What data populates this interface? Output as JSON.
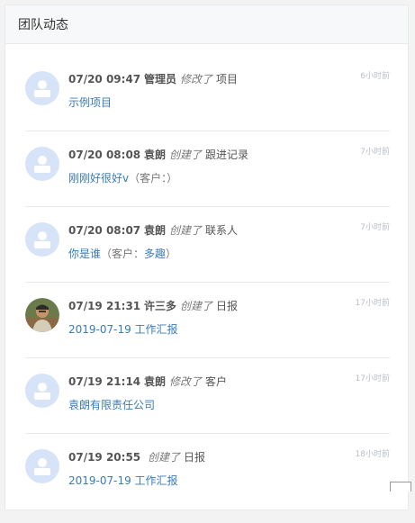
{
  "panel": {
    "title": "团队动态"
  },
  "feed": [
    {
      "time": "07/20 09:47",
      "user": "管理员",
      "action": "修改了",
      "type": "项目",
      "ago": "6小时前",
      "link": "示例项目",
      "customer_label": "",
      "customer": "",
      "customer_close": "",
      "avatar": "default"
    },
    {
      "time": "07/20 08:08",
      "user": "袁朗",
      "action": "创建了",
      "type": "跟进记录",
      "ago": "7小时前",
      "link": "刚刚好很好v",
      "customer_label": "（客户：",
      "customer": "",
      "customer_close": "）",
      "avatar": "default"
    },
    {
      "time": "07/20 08:07",
      "user": "袁朗",
      "action": "创建了",
      "type": "联系人",
      "ago": "7小时前",
      "link": "你是谁",
      "customer_label": "（客户：",
      "customer": "多趣",
      "customer_close": "）",
      "avatar": "default"
    },
    {
      "time": "07/19 21:31",
      "user": "许三多",
      "action": "创建了",
      "type": "日报",
      "ago": "17小时前",
      "link": "2019-07-19 工作汇报",
      "customer_label": "",
      "customer": "",
      "customer_close": "",
      "avatar": "photo"
    },
    {
      "time": "07/19 21:14",
      "user": "袁朗",
      "action": "修改了",
      "type": "客户",
      "ago": "17小时前",
      "link": "袁朗有限责任公司",
      "customer_label": "",
      "customer": "",
      "customer_close": "",
      "avatar": "default"
    },
    {
      "time": "07/19 20:55",
      "user": "",
      "action": "创建了",
      "type": "日报",
      "ago": "18小时前",
      "link": "2019-07-19 工作汇报",
      "customer_label": "",
      "customer": "",
      "customer_close": "",
      "avatar": "default"
    }
  ],
  "colors": {
    "link": "#3a7bb8",
    "avatar_bg": "#d7e4f7",
    "avatar_fg": "#ffffff"
  }
}
